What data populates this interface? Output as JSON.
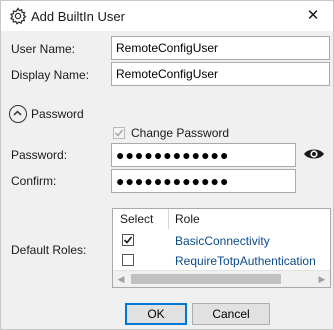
{
  "window": {
    "title": "Add BuiltIn User",
    "close_glyph": "✕",
    "title_icon": "gear-icon"
  },
  "form": {
    "user_name_label": "User Name:",
    "user_name_value": "RemoteConfigUser",
    "display_name_label": "Display Name:",
    "display_name_value": "RemoteConfigUser",
    "password_section_label": "Password",
    "change_password_label": "Change Password",
    "change_password_checked": true,
    "password_label": "Password:",
    "password_value": "●●●●●●●●●●●●",
    "confirm_label": "Confirm:",
    "confirm_value": "●●●●●●●●●●●●",
    "default_roles_label": "Default Roles:"
  },
  "roles_grid": {
    "columns": [
      "Select",
      "Role"
    ],
    "rows": [
      {
        "selected": true,
        "role": "BasicConnectivity"
      },
      {
        "selected": false,
        "role": "RequireTotpAuthentication"
      }
    ]
  },
  "buttons": {
    "ok": "OK",
    "cancel": "Cancel"
  },
  "colors": {
    "accent": "#0078d7",
    "link_text": "#0b4a8b",
    "window_bg": "#f0f0f0"
  }
}
